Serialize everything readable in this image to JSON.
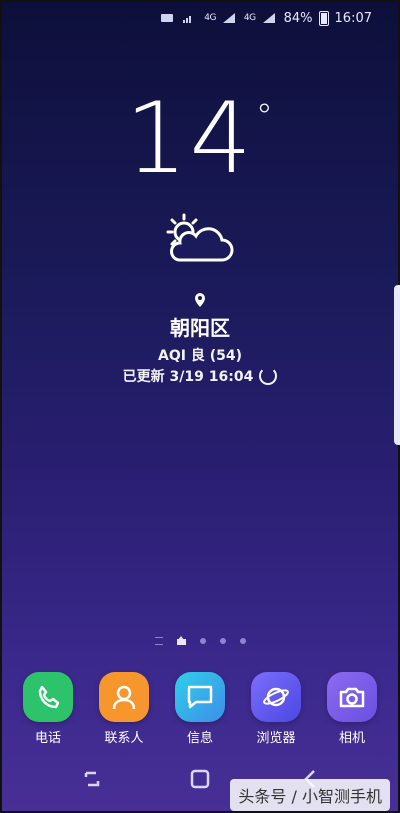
{
  "status_bar": {
    "battery": "84%",
    "time": "16:07",
    "network_1": "4G",
    "network_2": "4G"
  },
  "weather": {
    "temperature": "14",
    "degree_symbol": "°",
    "location": "朝阳区",
    "aqi": "AQI 良 (54)",
    "updated": "已更新 3/19 16:04"
  },
  "dock": {
    "apps": [
      {
        "label": "电话",
        "icon": "phone-icon",
        "color": "#2cc36b"
      },
      {
        "label": "联系人",
        "icon": "contacts-icon",
        "color": "#f7962d"
      },
      {
        "label": "信息",
        "icon": "messages-icon",
        "color": "#2fb9e8"
      },
      {
        "label": "浏览器",
        "icon": "browser-icon",
        "color": "#6a63ff"
      },
      {
        "label": "相机",
        "icon": "camera-icon",
        "color": "#7b5ee8"
      }
    ]
  },
  "watermark": "头条号 / 小智测手机"
}
